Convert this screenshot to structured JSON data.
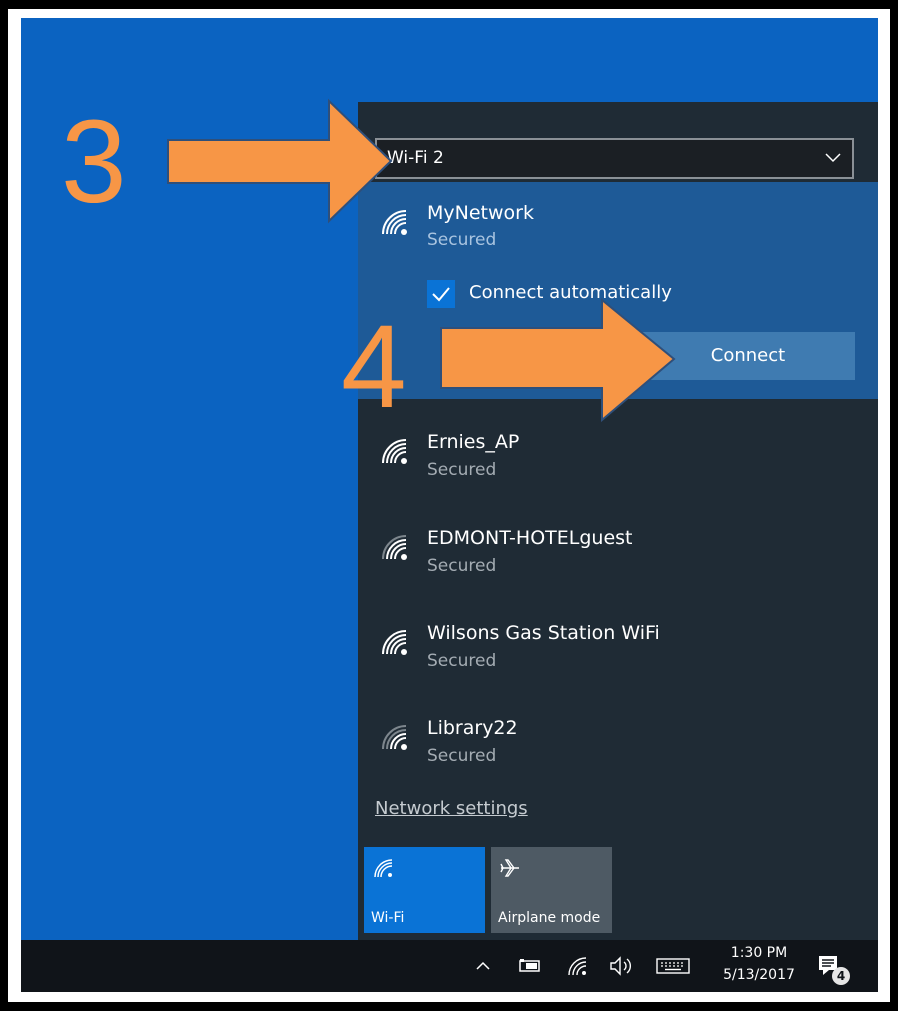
{
  "flyout": {
    "adapter": "Wi-Fi 2",
    "selected_network": {
      "name": "MyNetwork",
      "status": "Secured",
      "connect_auto_label": "Connect automatically",
      "connect_auto_checked": true,
      "connect_button": "Connect"
    },
    "networks": [
      {
        "name": "Ernies_AP",
        "status": "Secured"
      },
      {
        "name": "EDMONT-HOTELguest",
        "status": "Secured"
      },
      {
        "name": "Wilsons Gas Station WiFi",
        "status": "Secured"
      },
      {
        "name": "Library22",
        "status": "Secured"
      }
    ],
    "network_settings": "Network settings",
    "tiles": {
      "wifi": "Wi-Fi",
      "airplane": "Airplane mode"
    }
  },
  "taskbar": {
    "time": "1:30 PM",
    "date": "5/13/2017",
    "notification_count": "4",
    "icons": [
      "chevron-up-icon",
      "battery-icon",
      "wifi-icon",
      "volume-icon",
      "keyboard-icon",
      "action-center-icon"
    ]
  },
  "annotations": {
    "step_a": "3",
    "step_b": "4",
    "color": "#f79646"
  },
  "colors": {
    "desktop": "#0b63c1",
    "flyout": "#1f2b35",
    "selected": "#1e5a97",
    "accent": "#0a73d6"
  }
}
